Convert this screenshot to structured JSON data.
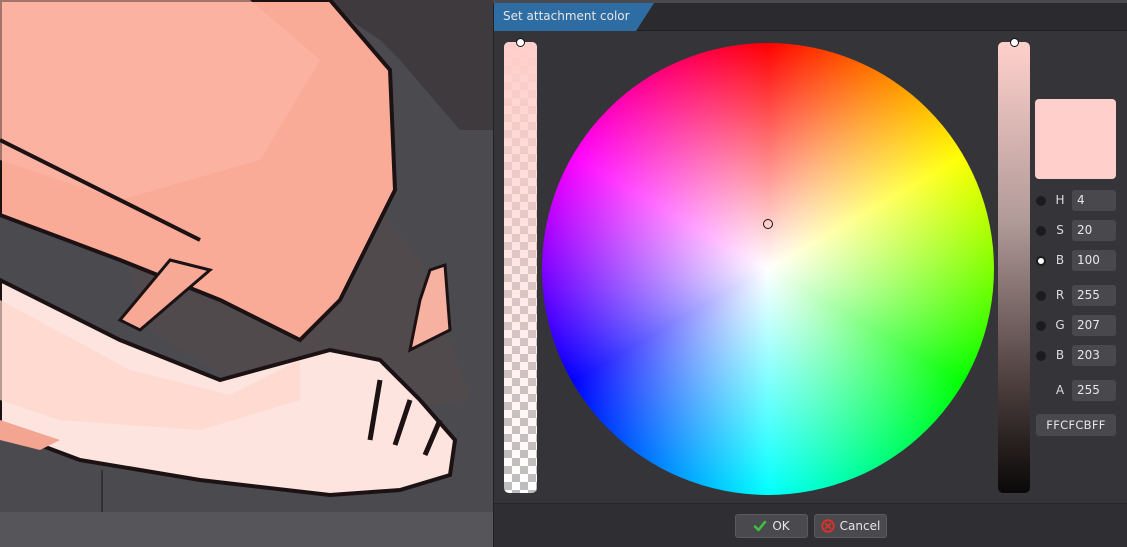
{
  "dialog": {
    "title": "Set attachment color",
    "ok_label": "OK",
    "cancel_label": "Cancel"
  },
  "color": {
    "hex": "FFCFCBFF",
    "preview_hex": "#ffcfcb",
    "alpha_fraction": 1.0,
    "brightness_fraction": 1.0,
    "hue_deg": 4,
    "saturation_fraction": 0.2
  },
  "fields": {
    "h": {
      "label": "H",
      "value": "4"
    },
    "s": {
      "label": "S",
      "value": "20"
    },
    "bri": {
      "label": "B",
      "value": "100"
    },
    "r": {
      "label": "R",
      "value": "255"
    },
    "g": {
      "label": "G",
      "value": "207"
    },
    "b": {
      "label": "B",
      "value": "203"
    },
    "a": {
      "label": "A",
      "value": "255"
    }
  },
  "icons": {
    "ok": "check-icon",
    "cancel": "cancel-icon"
  },
  "colors": {
    "accent_tab": "#2e6da4",
    "ok_check": "#3ec33e",
    "cancel_red": "#e0302a"
  }
}
